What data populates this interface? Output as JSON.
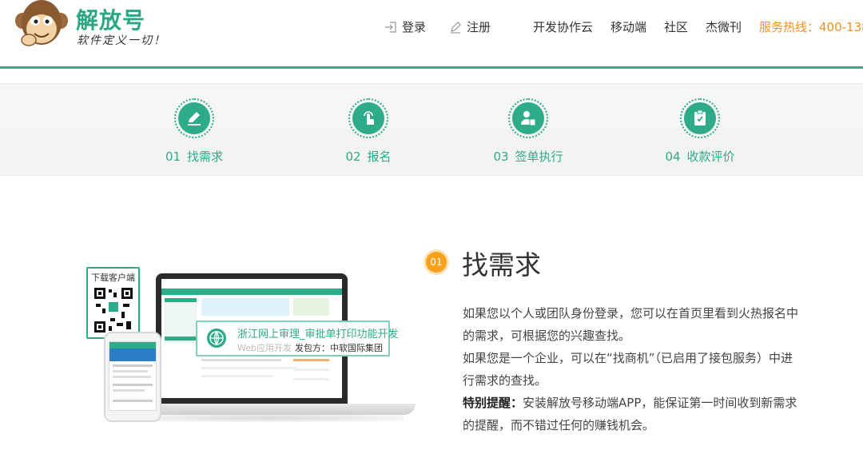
{
  "brand": {
    "name": "解放号",
    "slogan": "软件定义一切！"
  },
  "nav": {
    "login": "登录",
    "register": "注册",
    "cloud": "开发协作云",
    "mobile": "移动端",
    "community": "社区",
    "weekly": "杰微刊",
    "hotline": "服务热线：400-138"
  },
  "steps": [
    {
      "num": "01",
      "label": "找需求",
      "icon": "pencil-icon"
    },
    {
      "num": "02",
      "label": "报名",
      "icon": "tap-hand-icon"
    },
    {
      "num": "03",
      "label": "签单执行",
      "icon": "user-sign-icon"
    },
    {
      "num": "04",
      "label": "收款评价",
      "icon": "clipboard-icon"
    }
  ],
  "illustration": {
    "qr_title": "下载客户端",
    "popup_title": "浙江网上审理_审批单打印功能开发",
    "popup_muted": "Web应用开发",
    "popup_sub": "发包方：中软国际集团"
  },
  "section": {
    "badge": "01",
    "title": "找需求",
    "para1": "如果您以个人或团队身份登录，您可以在首页里看到火热报名中的需求，可根据您的兴趣查找。",
    "para2": "如果您是一个企业，可以在“找商机”（已启用了接包服务）中进行需求的查找。",
    "tip_label": "特别提醒：",
    "tip_text": "安装解放号移动端APP，能保证第一时间收到新需求的提醒，而不错过任何的赚钱机会。"
  },
  "colors": {
    "brand_green": "#2eab88",
    "hotline_orange": "#f39021",
    "badge_orange": "#f6a21e"
  }
}
